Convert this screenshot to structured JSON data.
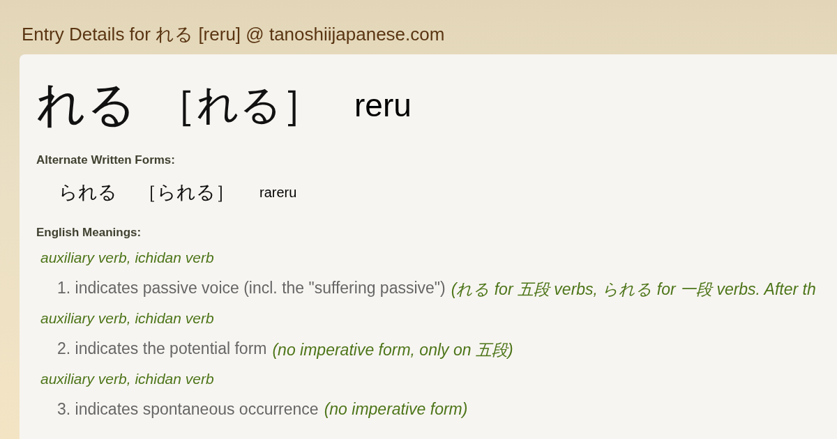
{
  "page_title": "Entry Details for れる [reru] @ tanoshiijapanese.com",
  "entry": {
    "word": "れる",
    "reading": "［れる］",
    "romaji": "reru"
  },
  "alternate_forms": {
    "heading": "Alternate Written Forms:",
    "items": [
      {
        "word": "られる",
        "reading": "［られる］",
        "romaji": "rareru"
      }
    ]
  },
  "meanings": {
    "heading": "English Meanings:",
    "senses": [
      {
        "pos": "auxiliary verb, ichidan verb",
        "gloss": "1. indicates passive voice (incl. the \"suffering passive\")",
        "note": "(れる for 五段 verbs, られる for 一段 verbs. After th"
      },
      {
        "pos": "auxiliary verb, ichidan verb",
        "gloss": "2. indicates the potential form",
        "note": "(no imperative form, only on 五段)"
      },
      {
        "pos": "auxiliary verb, ichidan verb",
        "gloss": "3. indicates spontaneous occurrence",
        "note": "(no imperative form)"
      }
    ]
  }
}
